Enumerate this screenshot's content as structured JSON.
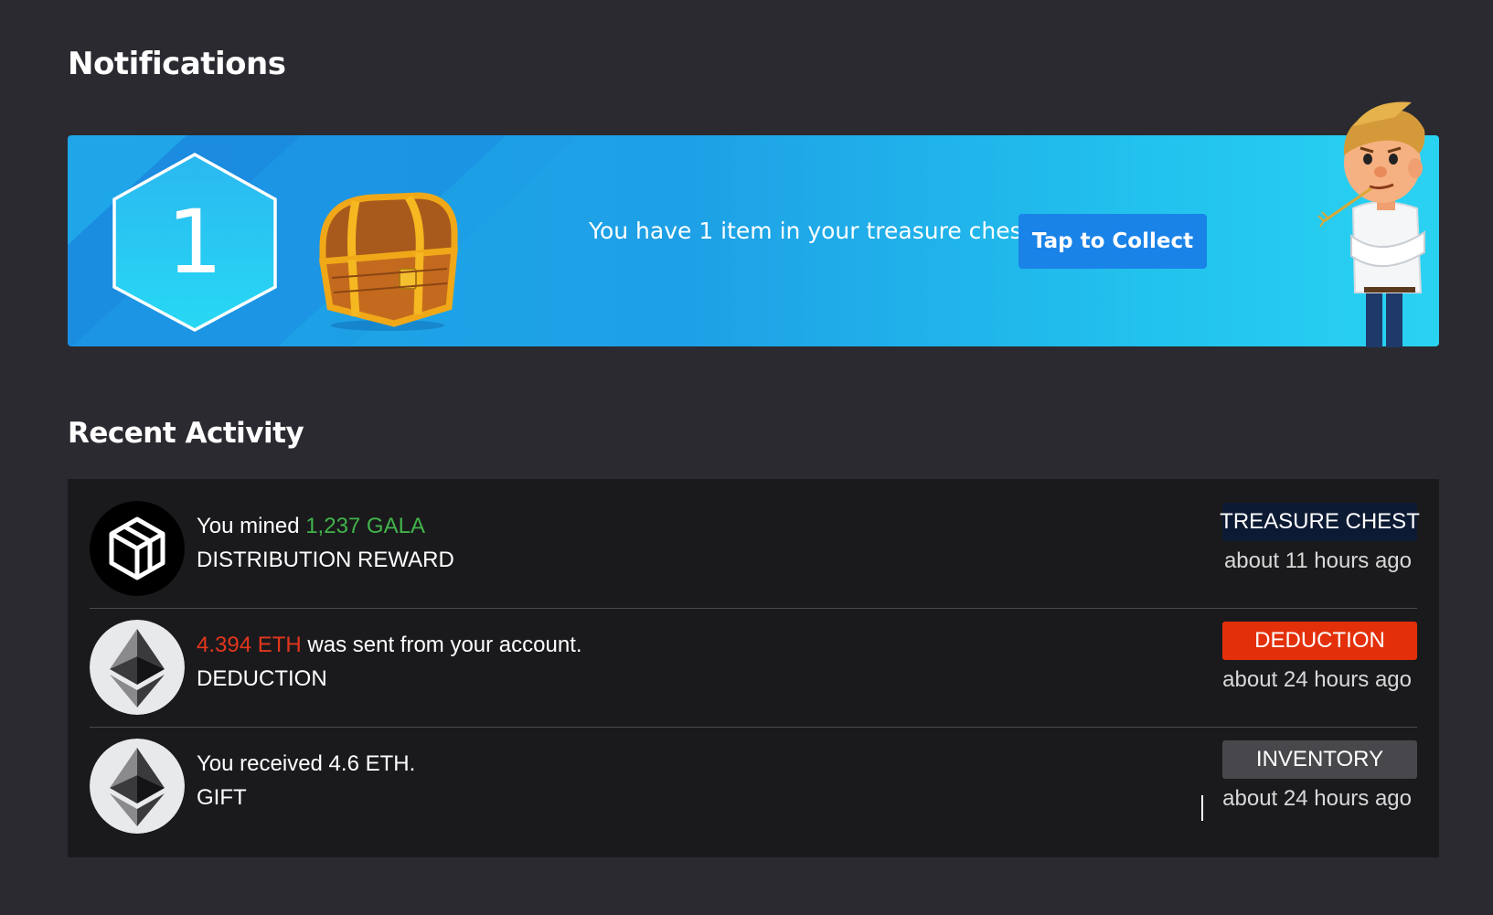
{
  "page": {
    "title": "Notifications"
  },
  "banner": {
    "count": "1",
    "message": "You have 1 item in your treasure chest!",
    "button_label": "Tap to Collect"
  },
  "recent": {
    "title": "Recent Activity",
    "items": [
      {
        "icon": "gala-cube-icon",
        "prefix": "You mined ",
        "highlight": "1,237 GALA",
        "suffix": "",
        "subtitle": "DISTRIBUTION REWARD",
        "badge": "TREASURE CHEST",
        "badge_color": "#0d1a33",
        "time": "about 11 hours ago"
      },
      {
        "icon": "ethereum-icon",
        "prefix": "",
        "highlight": "4.394 ETH",
        "suffix": " was sent from your account.",
        "subtitle": "DEDUCTION",
        "badge": "DEDUCTION",
        "badge_color": "#e3300a",
        "time": "about 24 hours ago"
      },
      {
        "icon": "ethereum-icon",
        "prefix": "You received 4.6 ETH.",
        "highlight": "",
        "suffix": "",
        "subtitle": "GIFT",
        "badge": "INVENTORY",
        "badge_color": "#48484c",
        "time": "about 24 hours ago"
      }
    ]
  },
  "colors": {
    "background": "#2b2a30",
    "panel": "#1a1a1d",
    "banner_accent": "#1fa6e8",
    "button": "#1a83e8",
    "positive": "#42b34a",
    "negative": "#e3361c"
  }
}
